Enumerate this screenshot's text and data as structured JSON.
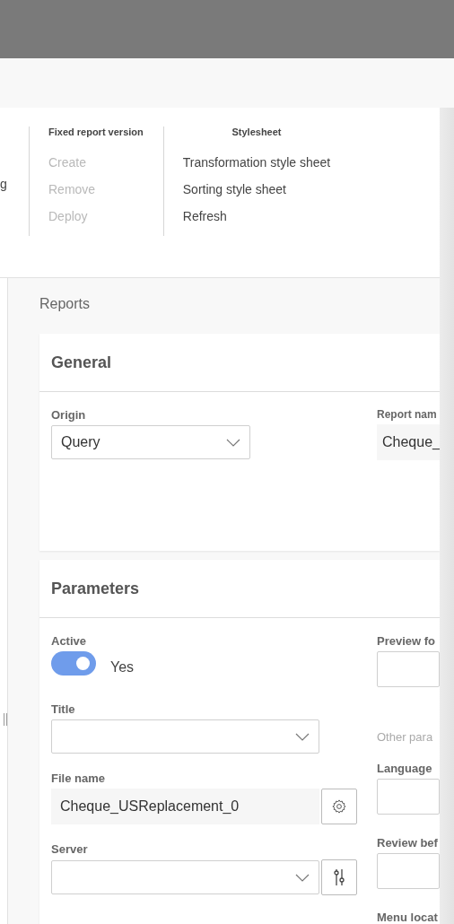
{
  "ribbon": {
    "cut_item": "g",
    "groups": [
      {
        "title": "Fixed report version",
        "items": [
          {
            "label": "Create",
            "disabled": true
          },
          {
            "label": "Remove",
            "disabled": true
          },
          {
            "label": "Deploy",
            "disabled": true
          }
        ]
      },
      {
        "title": "Stylesheet",
        "items": [
          {
            "label": "Transformation style sheet",
            "disabled": false
          },
          {
            "label": "Sorting style sheet",
            "disabled": false
          },
          {
            "label": "Refresh",
            "disabled": false
          }
        ]
      }
    ]
  },
  "page_title": "Reports",
  "sections": [
    {
      "title": "General",
      "left": [
        {
          "kind": "select",
          "label": "Origin",
          "value": "Query"
        }
      ],
      "right": [
        {
          "kind": "readonly",
          "label": "Report nam",
          "value": "Cheque_"
        }
      ]
    },
    {
      "title": "Parameters",
      "left": [
        {
          "kind": "toggle",
          "label": "Active",
          "on": true,
          "text": "Yes"
        },
        {
          "kind": "select",
          "label": "Title"
        },
        {
          "kind": "readonly-settings",
          "label": "File name",
          "value": "Cheque_USReplacement_0"
        },
        {
          "kind": "select-tools",
          "label": "Server"
        }
      ],
      "right": [
        {
          "kind": "input",
          "label": "Preview fo"
        },
        {
          "kind": "caption",
          "label": "Other para"
        },
        {
          "kind": "input",
          "label": "Language"
        },
        {
          "kind": "input",
          "label": "Review bef"
        },
        {
          "kind": "heading",
          "label": "Menu locat"
        }
      ]
    }
  ]
}
